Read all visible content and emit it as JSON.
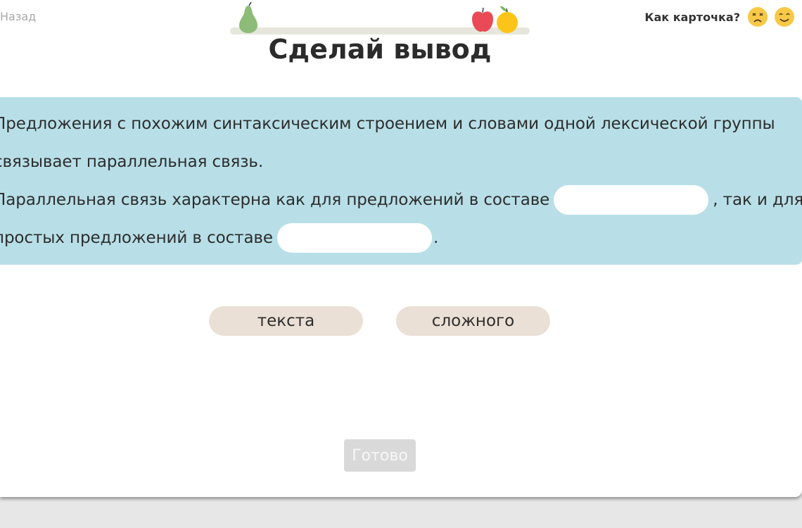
{
  "nav": {
    "back_label": "Назад"
  },
  "rating": {
    "label": "Как карточка?"
  },
  "title": "Сделай вывод",
  "task": {
    "line1": "Предложения с похожим синтаксическим строением и словами одной лексической группы",
    "line2": "связывает параллельная связь.",
    "line3_before": "Параллельная связь характерна как для предложений в составе",
    "line3_after": ", так и для",
    "line4_before": "простых предложений в составе",
    "line4_after": "."
  },
  "options": [
    {
      "label": "текста"
    },
    {
      "label": "сложного"
    }
  ],
  "done_label": "Готово",
  "colors": {
    "panel": "#b8dfe7",
    "chip": "#eae0d5",
    "button_disabled": "#d9d9d9",
    "progress_track": "#e6e6dc"
  },
  "icons": [
    "pear-icon",
    "apple-icon",
    "orange-icon",
    "sad-face-icon",
    "happy-face-icon"
  ]
}
